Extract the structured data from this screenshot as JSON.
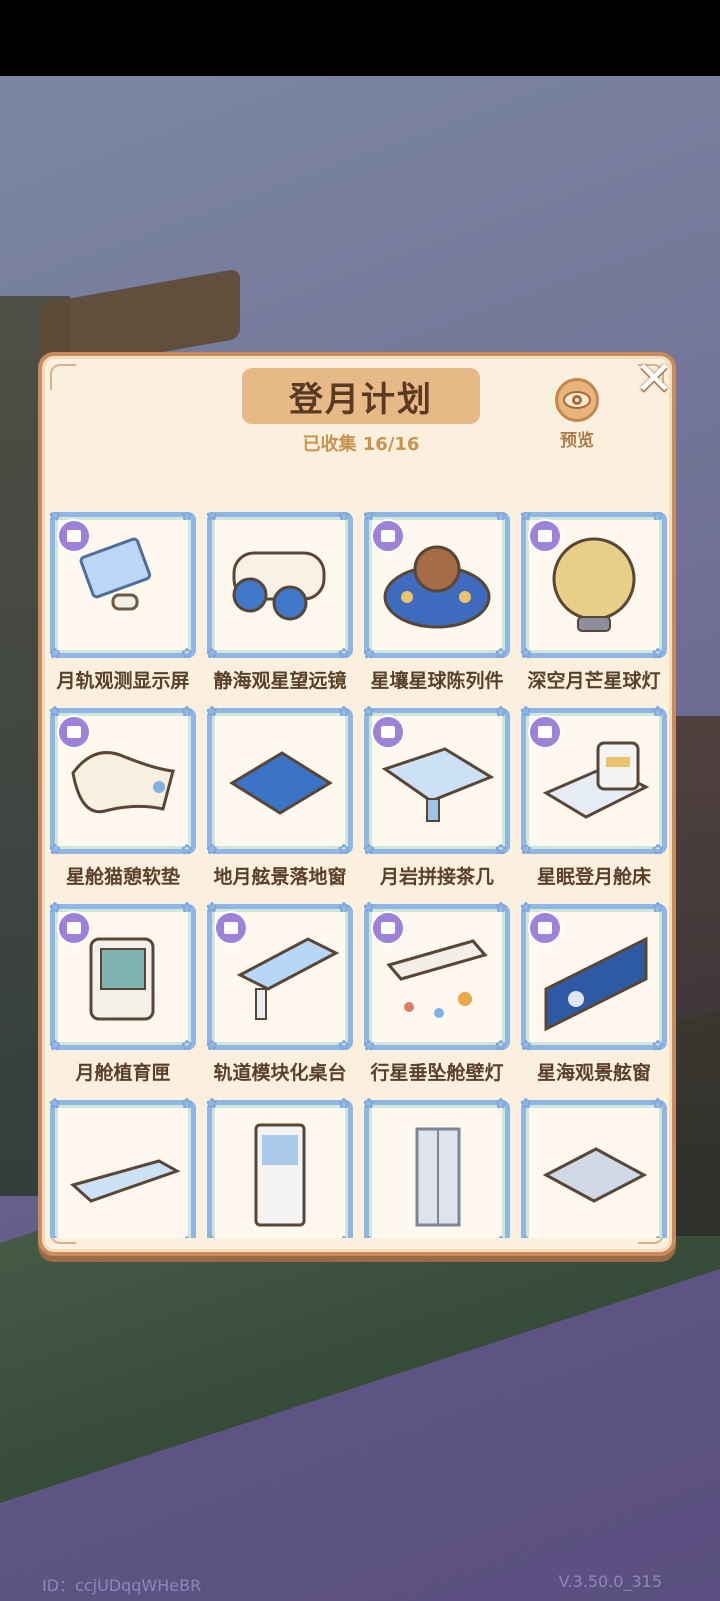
{
  "footer": {
    "id_text": "ID：ccjUDqqWHeBR",
    "version": "V.3.50.0_315"
  },
  "panel": {
    "title": "登月计划",
    "progress": "已收集 16/16",
    "preview_label": "预览",
    "close_icon": "close-x"
  },
  "items": [
    {
      "name": "月轨观测显示屏",
      "art": "monitor",
      "badge": true
    },
    {
      "name": "静海观星望远镜",
      "art": "binocular",
      "badge": false
    },
    {
      "name": "星壤星球陈列件",
      "art": "planets",
      "badge": true
    },
    {
      "name": "深空月芒星球灯",
      "art": "moon",
      "badge": true
    },
    {
      "name": "星舱猫憩软垫",
      "art": "cushion",
      "badge": true
    },
    {
      "name": "地月舷景落地窗",
      "art": "window",
      "badge": false
    },
    {
      "name": "月岩拼接茶几",
      "art": "table",
      "badge": true
    },
    {
      "name": "星眠登月舱床",
      "art": "bed",
      "badge": true
    },
    {
      "name": "月舱植育匣",
      "art": "plantbox",
      "badge": true
    },
    {
      "name": "轨道模块化桌台",
      "art": "desk",
      "badge": true
    },
    {
      "name": "行星垂坠舱壁灯",
      "art": "lamp",
      "badge": true
    },
    {
      "name": "星海观景舷窗",
      "art": "porthole",
      "badge": true
    },
    {
      "name": "",
      "art": "slab",
      "badge": false
    },
    {
      "name": "",
      "art": "shelf",
      "badge": false
    },
    {
      "name": "",
      "art": "door",
      "badge": false
    },
    {
      "name": "",
      "art": "mat",
      "badge": false
    }
  ],
  "colors": {
    "frame": "#c98b5d",
    "card_border": "#8fb6e4",
    "badge": "#9d82d8",
    "text": "#5a3f2a"
  }
}
